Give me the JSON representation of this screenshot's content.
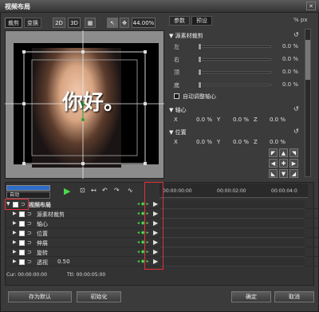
{
  "window": {
    "title": "视频布局",
    "close": "✕"
  },
  "left_tabs": [
    "裁剪",
    "变换"
  ],
  "toolbar": {
    "btn_2d": "2D",
    "btn_3d": "3D",
    "zoom": "44.00%"
  },
  "right_tabs": [
    "参数",
    "预设"
  ],
  "units": "% px",
  "preview_text": "你好。",
  "sections": {
    "crop": "源素材裁剪",
    "axis": "轴心",
    "position": "位置"
  },
  "crop_params": [
    {
      "label": "左",
      "value": "0.0 %"
    },
    {
      "label": "右",
      "value": "0.0 %"
    },
    {
      "label": "顶",
      "value": "0.0 %"
    },
    {
      "label": "底",
      "value": "0.0 %"
    }
  ],
  "auto_axis_label": "自动调整轴心",
  "axis_row": {
    "x_label": "X",
    "x_val": "0.0 %",
    "y_label": "Y",
    "y_val": "0.0 %",
    "z_label": "Z",
    "z_val": "0.0 %"
  },
  "position_row": {
    "x_label": "X",
    "x_val": "0.0 %",
    "y_label": "Y",
    "y_val": "0.0 %",
    "z_label": "Z",
    "z_val": "0.0 %"
  },
  "timeline": {
    "mode": "自动",
    "ruler": [
      "00:00:00:00",
      "00:00:02:00",
      "00:00:04:0"
    ],
    "tracks": [
      "视频布局",
      "源素材裁剪",
      "轴心",
      "位置",
      "伸展",
      "旋转",
      "透视"
    ],
    "perspective_value": "0.50",
    "cur": "Cur: 00:00:00:00",
    "ttl": "Ttl: 00:00:05:00"
  },
  "buttons": {
    "save_default": "存为默认",
    "init": "初始化",
    "ok": "确定",
    "cancel": "取消"
  }
}
